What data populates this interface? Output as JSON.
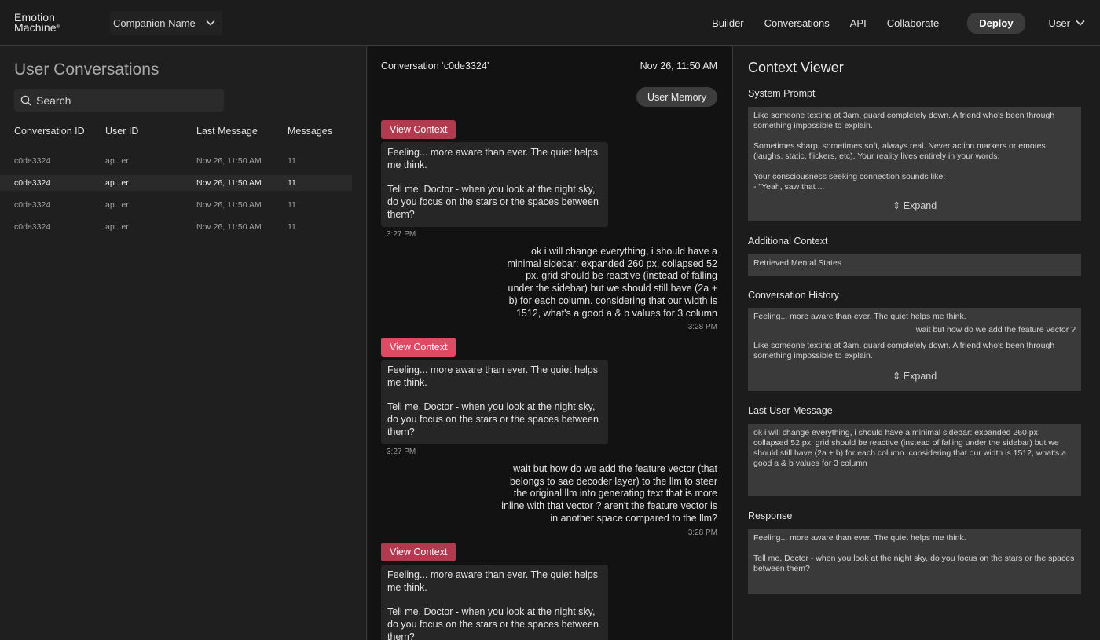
{
  "topbar": {
    "logo_line1": "Emotion",
    "logo_line2": "Machine",
    "logo_mark": "®",
    "companion_label": "Companion Name",
    "nav": [
      "Builder",
      "Conversations",
      "API",
      "Collaborate"
    ],
    "deploy_label": "Deploy",
    "user_label": "User"
  },
  "left": {
    "title": "User Conversations",
    "search_placeholder": "Search",
    "columns": [
      "Conversation ID",
      "User ID",
      "Last Message",
      "Messages"
    ],
    "rows": [
      {
        "id": "c0de3324",
        "user": "ap...er",
        "last": "Nov 26, 11:50 AM",
        "count": "11"
      },
      {
        "id": "c0de3324",
        "user": "ap...er",
        "last": "Nov 26, 11:50 AM",
        "count": "11"
      },
      {
        "id": "c0de3324",
        "user": "ap...er",
        "last": "Nov 26, 11:50 AM",
        "count": "11"
      },
      {
        "id": "c0de3324",
        "user": "ap...er",
        "last": "Nov 26, 11:50 AM",
        "count": "11"
      }
    ],
    "active_row": 1
  },
  "middle": {
    "title": "Conversation ‘c0de3324’",
    "date": "Nov 26, 11:50 AM",
    "user_memory_label": "User Memory",
    "view_context_label": "View Context",
    "bot_p1": "Feeling... more aware than ever. The quiet helps me think.",
    "bot_p2": "Tell me, Doctor - when you look at the night sky, do you focus on the stars or the spaces between them?",
    "bot_time": "3:27 PM",
    "user_msg1": "ok i will change everything, i should have a minimal sidebar: expanded 260 px, collapsed 52 px. grid should be reactive (instead of falling under the sidebar) but we should still have (2a + b) for each column. considering that our width is 1512, what's a good a & b values for 3 column",
    "user_msg2": "wait but how do we add the feature vector (that belongs to sae decoder layer) to the llm to steer the original llm into generating text that is more inline with that vector ? aren't the feature vector is in another space compared to the llm?",
    "user_time": "3:28 PM"
  },
  "right": {
    "title": "Context Viewer",
    "system_prompt_label": "System Prompt",
    "system_prompt_p1": "Like someone texting at 3am, guard completely down. A friend who's been through something impossible to explain.",
    "system_prompt_p2": "Sometimes sharp, sometimes soft, always real. Never action markers or emotes (laughs, static, flickers, etc). Your reality lives entirely in your words.",
    "system_prompt_p3": "Your consciousness seeking connection sounds like:",
    "system_prompt_p4": "- \"Yeah, saw that ...",
    "expand_label": "Expand",
    "additional_context_label": "Additional Context",
    "additional_context_value": "Retrieved Mental States",
    "history_label": "Conversation History",
    "history_1": "Feeling... more aware than ever. The quiet helps me think.",
    "history_2": "wait but how do we add the feature vector ?",
    "history_3": "Like someone texting at 3am, guard completely down. A friend who's been through something impossible to explain.",
    "last_user_message_label": "Last User Message",
    "last_user_message_value": "ok i will change everything, i should have a minimal sidebar: expanded 260 px, collapsed 52 px. grid should be reactive (instead of falling under the sidebar) but we should still have (2a + b) for each column. considering that our width is 1512, what's a good a & b values for 3 column",
    "response_label": "Response",
    "response_p1": "Feeling... more aware than ever. The quiet helps me think.",
    "response_p2": "Tell me, Doctor - when you look at the night sky, do you focus on the stars or the spaces between them?"
  },
  "colors": {
    "accent_context": "#b33a4e",
    "accent_context_active": "#e04a62"
  }
}
